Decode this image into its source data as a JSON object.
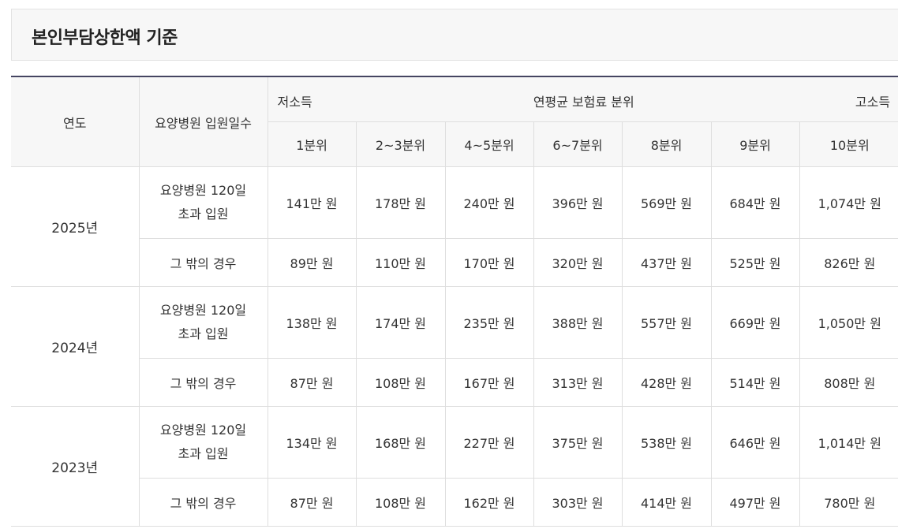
{
  "title": "본인부담상한액 기준",
  "header": {
    "year": "연도",
    "days": "요양병원 입원일수",
    "low_income": "저소득",
    "premium_percentile": "연평균 보험료 분위",
    "high_income": "고소득",
    "deciles": [
      "1분위",
      "2~3분위",
      "4~5분위",
      "6~7분위",
      "8분위",
      "9분위",
      "10분위"
    ]
  },
  "rows": [
    {
      "year": "2025년",
      "over120": {
        "label_line1": "요양병원 120일",
        "label_line2": "초과 입원",
        "values": [
          "141만 원",
          "178만 원",
          "240만 원",
          "396만 원",
          "569만 원",
          "684만 원",
          "1,074만 원"
        ]
      },
      "other": {
        "label": "그 밖의 경우",
        "values": [
          "89만 원",
          "110만 원",
          "170만 원",
          "320만 원",
          "437만 원",
          "525만 원",
          "826만 원"
        ]
      }
    },
    {
      "year": "2024년",
      "over120": {
        "label_line1": "요양병원 120일",
        "label_line2": "초과 입원",
        "values": [
          "138만 원",
          "174만 원",
          "235만 원",
          "388만 원",
          "557만 원",
          "669만 원",
          "1,050만 원"
        ]
      },
      "other": {
        "label": "그 밖의 경우",
        "values": [
          "87만 원",
          "108만 원",
          "167만 원",
          "313만 원",
          "428만 원",
          "514만 원",
          "808만 원"
        ]
      }
    },
    {
      "year": "2023년",
      "over120": {
        "label_line1": "요양병원 120일",
        "label_line2": "초과 입원",
        "values": [
          "134만 원",
          "168만 원",
          "227만 원",
          "375만 원",
          "538만 원",
          "646만 원",
          "1,014만 원"
        ]
      },
      "other": {
        "label": "그 밖의 경우",
        "values": [
          "87만 원",
          "108만 원",
          "162만 원",
          "303만 원",
          "414만 원",
          "497만 원",
          "780만 원"
        ]
      }
    }
  ]
}
